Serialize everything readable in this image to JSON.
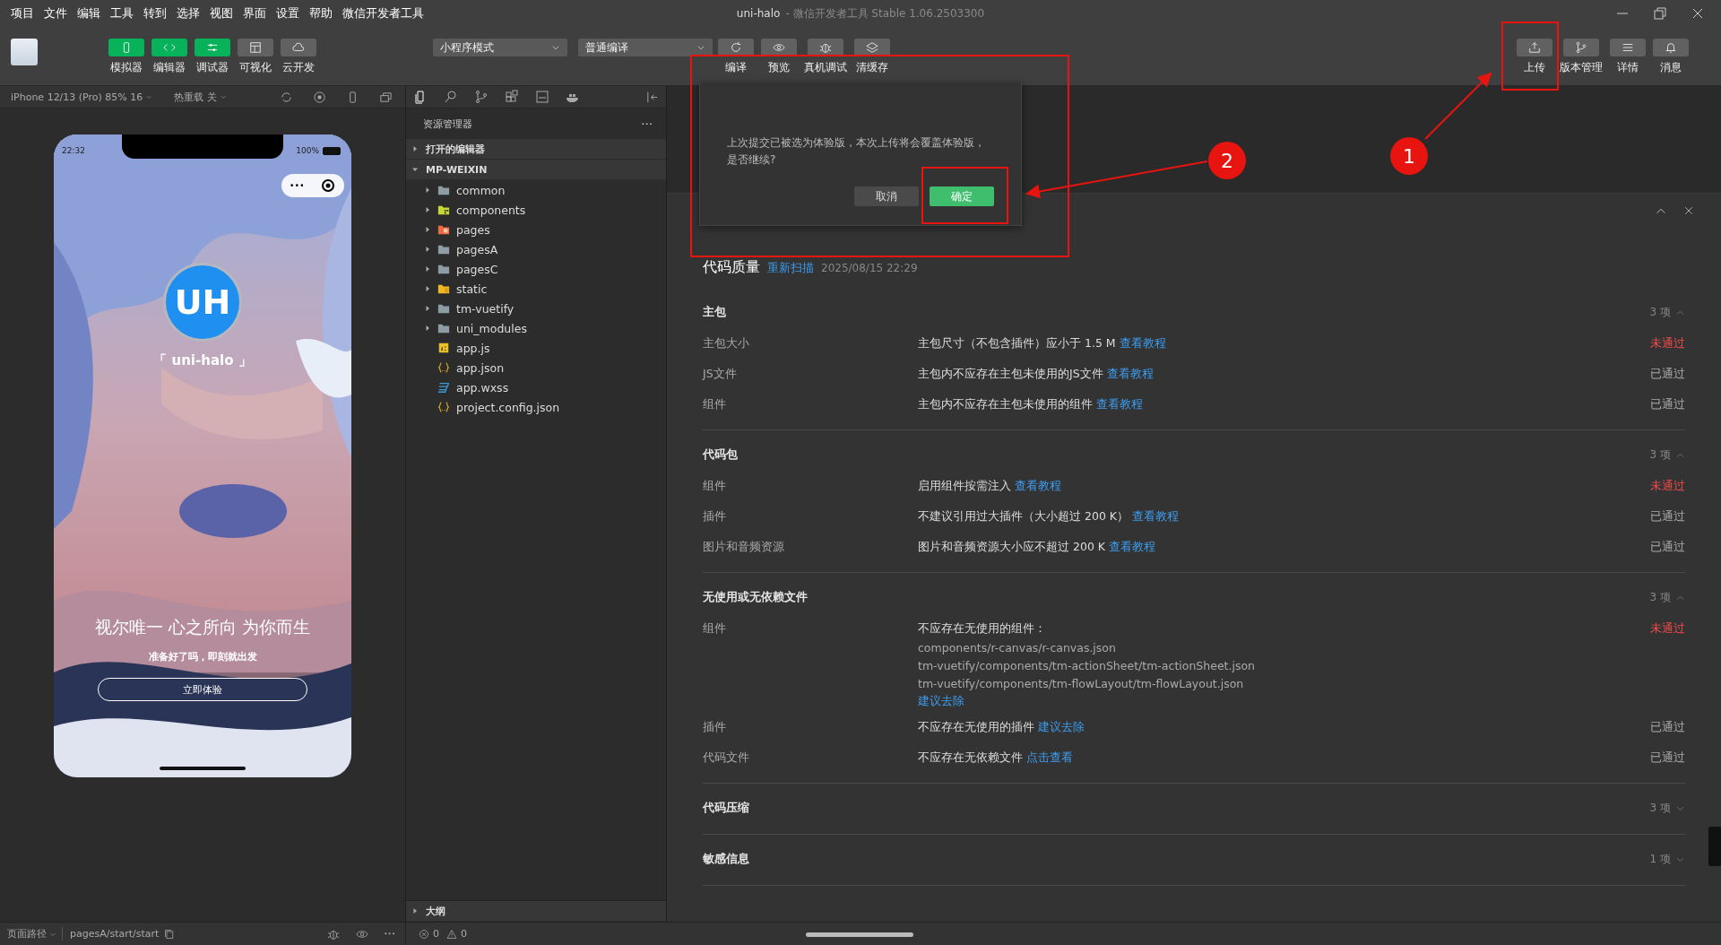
{
  "menu": [
    "项目",
    "文件",
    "编辑",
    "工具",
    "转到",
    "选择",
    "视图",
    "界面",
    "设置",
    "帮助",
    "微信开发者工具"
  ],
  "window": {
    "title": "uni-halo",
    "subtitle": "- 微信开发者工具 Stable 1.06.2503300"
  },
  "toolbar": {
    "views": [
      {
        "label": "模拟器",
        "on": true
      },
      {
        "label": "编辑器",
        "on": true
      },
      {
        "label": "调试器",
        "on": true
      },
      {
        "label": "可视化",
        "on": false
      },
      {
        "label": "云开发",
        "on": false
      }
    ],
    "mode": "小程序模式",
    "compile": "普通编译",
    "actions": [
      {
        "label": "编译"
      },
      {
        "label": "预览"
      },
      {
        "label": "真机调试"
      },
      {
        "label": "清缓存"
      }
    ],
    "right": [
      {
        "label": "上传"
      },
      {
        "label": "版本管理"
      },
      {
        "label": "详情"
      },
      {
        "label": "消息"
      }
    ]
  },
  "simulator": {
    "device": "iPhone 12/13 (Pro) 85% 16",
    "hot_reload": "热重载 关",
    "phone": {
      "time": "22:32",
      "battery": "100%",
      "logo": "UH",
      "app_name": "「 uni-halo 」",
      "slogan": "视尔唯一 心之所向 为你而生",
      "subtitle": "准备好了吗，即刻就出发",
      "button": "立即体验"
    }
  },
  "explorer": {
    "title": "资源管理器",
    "sections": [
      {
        "label": "打开的编辑器",
        "expanded": false
      },
      {
        "label": "MP-WEIXIN",
        "expanded": true
      }
    ],
    "files": [
      {
        "name": "common",
        "kind": "folder"
      },
      {
        "name": "components",
        "kind": "components"
      },
      {
        "name": "pages",
        "kind": "pages"
      },
      {
        "name": "pagesA",
        "kind": "folder"
      },
      {
        "name": "pagesC",
        "kind": "folder"
      },
      {
        "name": "static",
        "kind": "static"
      },
      {
        "name": "tm-vuetify",
        "kind": "folder"
      },
      {
        "name": "uni_modules",
        "kind": "folder"
      },
      {
        "name": "app.js",
        "kind": "js"
      },
      {
        "name": "app.json",
        "kind": "json"
      },
      {
        "name": "app.wxss",
        "kind": "wxss"
      },
      {
        "name": "project.config.json",
        "kind": "json"
      }
    ],
    "outline": {
      "label": "大纲",
      "expanded": false
    }
  },
  "dialog": {
    "message": "上次提交已被选为体验版，本次上传将会覆盖体验版，是否继续?",
    "buttons": [
      {
        "label": "取消",
        "kind": "secondary"
      },
      {
        "label": "确定",
        "kind": "primary"
      }
    ]
  },
  "report": {
    "title": "代码质量",
    "rescan": "重新扫描",
    "time": "2025/08/15 22:29",
    "sections": [
      {
        "title": "主包",
        "count": "3 项",
        "expanded": true,
        "items": [
          {
            "name": "主包大小",
            "text": "主包尺寸（不包含插件）应小于 1.5 M",
            "link": "查看教程",
            "status": "未通过",
            "passed": false
          },
          {
            "name": "JS文件",
            "text": "主包内不应存在主包未使用的JS文件",
            "link": "查看教程",
            "status": "已通过",
            "passed": true
          },
          {
            "name": "组件",
            "text": "主包内不应存在主包未使用的组件",
            "link": "查看教程",
            "status": "已通过",
            "passed": true
          }
        ]
      },
      {
        "title": "代码包",
        "count": "3 项",
        "expanded": true,
        "items": [
          {
            "name": "组件",
            "text": "启用组件按需注入",
            "link": "查看教程",
            "status": "未通过",
            "passed": false
          },
          {
            "name": "插件",
            "text": "不建议引用过大插件（大小超过 200 K）",
            "link": "查看教程",
            "status": "已通过",
            "passed": true
          },
          {
            "name": "图片和音频资源",
            "text": "图片和音频资源大小应不超过 200 K",
            "link": "查看教程",
            "status": "已通过",
            "passed": true
          }
        ]
      },
      {
        "title": "无使用或无依赖文件",
        "count": "3 项",
        "expanded": true,
        "items": [
          {
            "name": "组件",
            "text": "不应存在无使用的组件：",
            "files": [
              "components/r-canvas/r-canvas.json",
              "tm-vuetify/components/tm-actionSheet/tm-actionSheet.json",
              "tm-vuetify/components/tm-flowLayout/tm-flowLayout.json"
            ],
            "link": "建议去除",
            "status": "未通过",
            "passed": false
          },
          {
            "name": "插件",
            "text": "不应存在无使用的插件",
            "link": "建议去除",
            "status": "已通过",
            "passed": true
          },
          {
            "name": "代码文件",
            "text": "不应存在无依赖文件",
            "link": "点击查看",
            "status": "已通过",
            "passed": true
          }
        ]
      },
      {
        "title": "代码压缩",
        "count": "3 项",
        "expanded": false
      },
      {
        "title": "敏感信息",
        "count": "1 项",
        "expanded": false
      }
    ]
  },
  "annotations": [
    {
      "label": "2"
    },
    {
      "label": "1"
    }
  ],
  "status_bar": {
    "path_label": "页面路径",
    "path": "pagesA/start/start",
    "errors": "0",
    "warnings": "0"
  }
}
